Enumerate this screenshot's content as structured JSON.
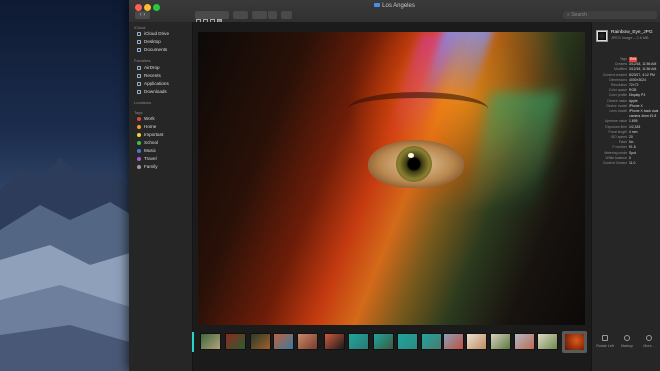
{
  "window": {
    "title": "Los Angeles"
  },
  "search": {
    "placeholder": "Search"
  },
  "sidebar": {
    "sections": [
      {
        "label": "iCloud"
      },
      {
        "label": "Favorites"
      },
      {
        "label": "Locations"
      },
      {
        "label": "Tags"
      }
    ],
    "icloud": [
      {
        "label": "iCloud Drive"
      },
      {
        "label": "Desktop"
      },
      {
        "label": "Documents"
      }
    ],
    "favorites": [
      {
        "label": "AirDrop"
      },
      {
        "label": "Recents"
      },
      {
        "label": "Applications"
      },
      {
        "label": "Downloads"
      }
    ],
    "tags": [
      {
        "label": "Work",
        "color": "#e0463a"
      },
      {
        "label": "Home",
        "color": "#f39a2b"
      },
      {
        "label": "Important",
        "color": "#f0d23a"
      },
      {
        "label": "School",
        "color": "#3fbf4a"
      },
      {
        "label": "Music",
        "color": "#3d7be0"
      },
      {
        "label": "Travel",
        "color": "#a659d6"
      },
      {
        "label": "Family",
        "color": "#9a9a9a"
      }
    ]
  },
  "inspector": {
    "file_name": "Rainbow_Eye_JPG",
    "file_kind": "JPEG image – 2.6 MB",
    "rows": [
      {
        "k": "Tags",
        "v": "Red"
      },
      {
        "k": "Created",
        "v": "3/12/18, 11:56 AM"
      },
      {
        "k": "Modified",
        "v": "3/12/18, 11:56 AM"
      },
      {
        "k": "Content created",
        "v": "8/23/17, 4:12 PM"
      },
      {
        "k": "Dimensions",
        "v": "4030×3024"
      },
      {
        "k": "Resolution",
        "v": "72×72"
      },
      {
        "k": "Color space",
        "v": "RGB"
      },
      {
        "k": "Color profile",
        "v": "Display P3"
      },
      {
        "k": "Device make",
        "v": "Apple"
      },
      {
        "k": "Device model",
        "v": "iPhone X"
      },
      {
        "k": "Lens model",
        "v": "iPhone X back dual"
      },
      {
        "k": "",
        "v": "camera 4mm f/1.8"
      },
      {
        "k": "Aperture value",
        "v": "1.695"
      },
      {
        "k": "Exposure time",
        "v": "1/2,183"
      },
      {
        "k": "Focal length",
        "v": "4 mm"
      },
      {
        "k": "ISO speed",
        "v": "20"
      },
      {
        "k": "Flash",
        "v": "No"
      },
      {
        "k": "F number",
        "v": "f/1.8"
      },
      {
        "k": "Metering mode",
        "v": "Spot"
      },
      {
        "k": "White balance",
        "v": "0"
      },
      {
        "k": "Content Creator",
        "v": "11.0"
      }
    ],
    "actions": [
      {
        "label": "Rotate Left"
      },
      {
        "label": "Markup"
      },
      {
        "label": "More..."
      }
    ]
  }
}
